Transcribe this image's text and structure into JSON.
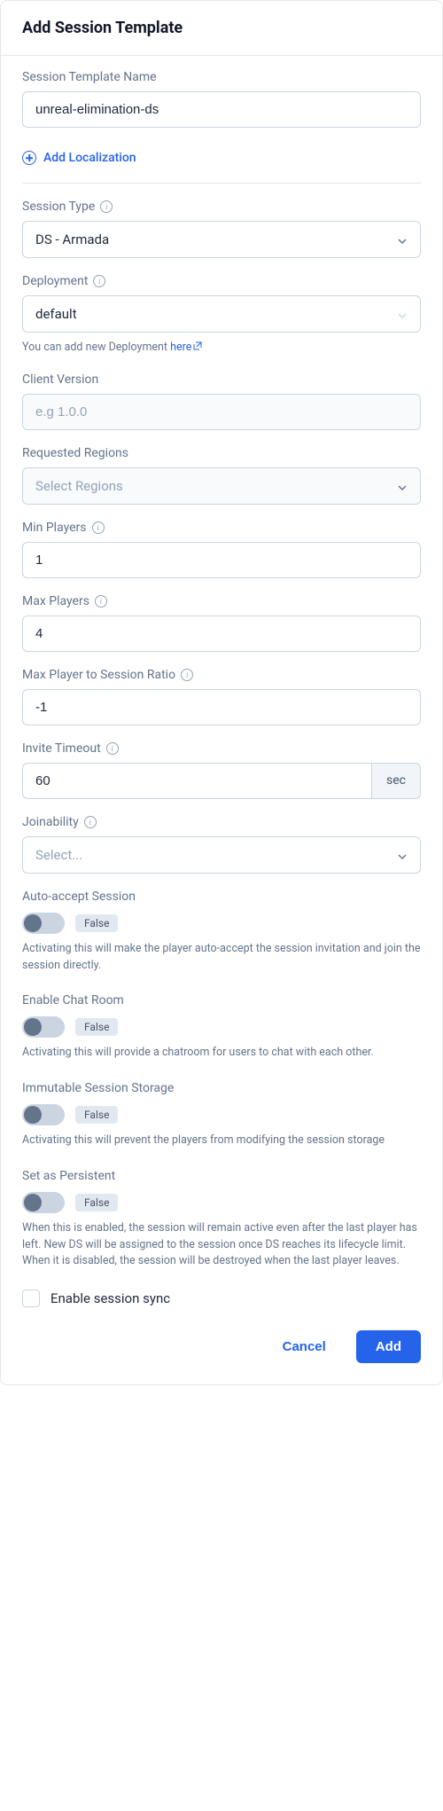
{
  "header": {
    "title": "Add Session Template"
  },
  "fields": {
    "templateName": {
      "label": "Session Template Name",
      "value": "unreal-elimination-ds"
    },
    "addLocalization": "Add Localization",
    "sessionType": {
      "label": "Session Type",
      "value": "DS - Armada"
    },
    "deployment": {
      "label": "Deployment",
      "value": "default",
      "hintPrefix": "You can add new Deployment ",
      "hintLink": "here"
    },
    "clientVersion": {
      "label": "Client Version",
      "placeholder": "e.g 1.0.0"
    },
    "requestedRegions": {
      "label": "Requested Regions",
      "placeholder": "Select Regions"
    },
    "minPlayers": {
      "label": "Min Players",
      "value": "1"
    },
    "maxPlayers": {
      "label": "Max Players",
      "value": "4"
    },
    "maxPlayerRatio": {
      "label": "Max Player to Session Ratio",
      "value": "-1"
    },
    "inviteTimeout": {
      "label": "Invite Timeout",
      "value": "60",
      "unit": "sec"
    },
    "joinability": {
      "label": "Joinability",
      "placeholder": "Select..."
    }
  },
  "toggles": {
    "autoAccept": {
      "label": "Auto-accept Session",
      "badge": "False",
      "desc": "Activating this will make the player auto-accept the session invitation and join the session directly."
    },
    "enableChat": {
      "label": "Enable Chat Room",
      "badge": "False",
      "desc": "Activating this will provide a chatroom for users to chat with each other."
    },
    "immutableStorage": {
      "label": "Immutable Session Storage",
      "badge": "False",
      "desc": "Activating this will prevent the players from modifying the session storage"
    },
    "persistent": {
      "label": "Set as Persistent",
      "badge": "False",
      "desc": "When this is enabled, the session will remain active even after the last player has left. New DS will be assigned to the session once DS reaches its lifecycle limit. When it is disabled, the session will be destroyed when the last player leaves."
    }
  },
  "sessionSync": {
    "label": "Enable session sync"
  },
  "footer": {
    "cancel": "Cancel",
    "add": "Add"
  }
}
